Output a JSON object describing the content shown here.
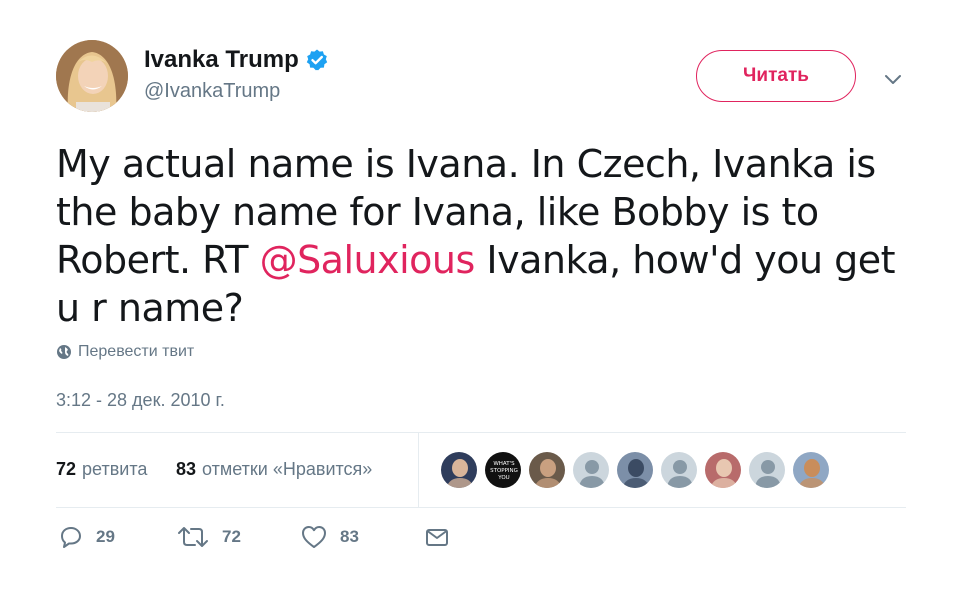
{
  "user": {
    "display_name": "Ivanka Trump",
    "handle": "@IvankaTrump",
    "verified": true
  },
  "follow_button": {
    "label": "Читать"
  },
  "tweet": {
    "text_part1": "My actual name is Ivana. In Czech, Ivanka is the baby name for Ivana, like Bobby is to Robert. RT ",
    "mention": "@Saluxious",
    "text_part2": " Ivanka, how'd you get u r name?"
  },
  "translate": {
    "label": "Перевести твит",
    "icon": "globe-icon"
  },
  "timestamp": "3:12 - 28 дек. 2010 г.",
  "stats": {
    "retweets_count": "72",
    "retweets_label": "ретвита",
    "likes_count": "83",
    "likes_label": "отметки «Нравится»"
  },
  "liker_avatars": [
    {
      "kind": "photo",
      "bg": "#2f3d5c",
      "fg": "#d9b59a"
    },
    {
      "kind": "text-badge",
      "bg": "#111111",
      "text": "WHAT'S STOPPING YOU"
    },
    {
      "kind": "photo",
      "bg": "#6a5a4a",
      "fg": "#c9a080"
    },
    {
      "kind": "default",
      "bg": "#ccd6dd"
    },
    {
      "kind": "photo",
      "bg": "#7c8fa8",
      "fg": "#3b4b63"
    },
    {
      "kind": "default",
      "bg": "#ccd6dd"
    },
    {
      "kind": "photo",
      "bg": "#b86b6b",
      "fg": "#e8c7b1"
    },
    {
      "kind": "default",
      "bg": "#ccd6dd"
    },
    {
      "kind": "photo",
      "bg": "#8fa7c4",
      "fg": "#c98d5b"
    }
  ],
  "actions": {
    "reply_count": "29",
    "retweet_count": "72",
    "like_count": "83"
  },
  "colors": {
    "accent": "#e0245e",
    "verified": "#1da1f2",
    "muted": "#657786",
    "text": "#14171a"
  }
}
